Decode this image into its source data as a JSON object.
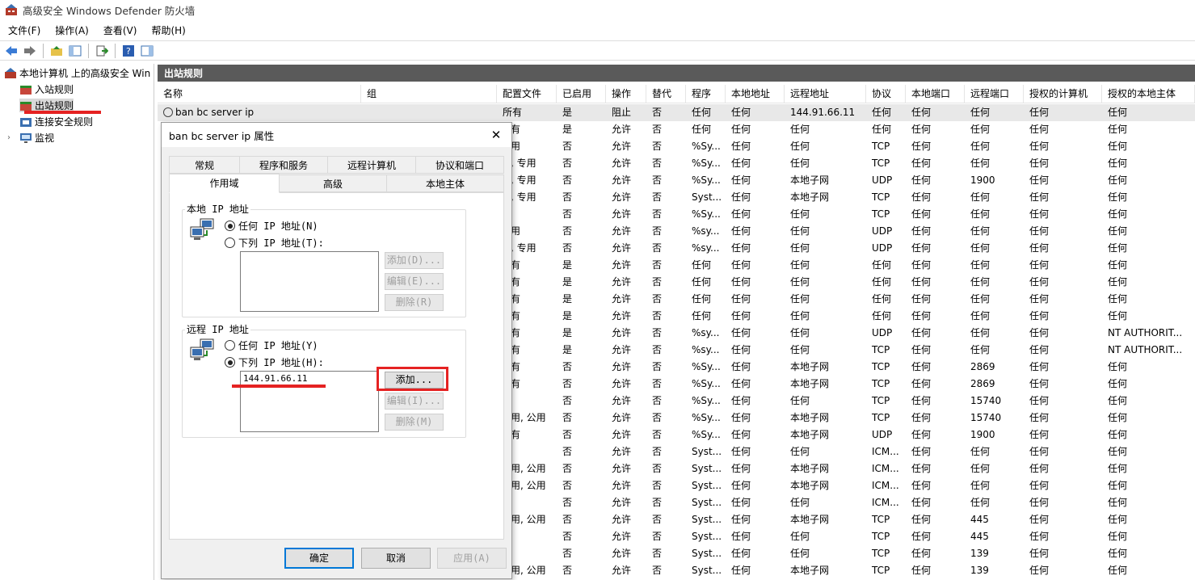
{
  "window": {
    "title": "高级安全 Windows Defender 防火墙"
  },
  "menu": [
    "文件(F)",
    "操作(A)",
    "查看(V)",
    "帮助(H)"
  ],
  "tree": {
    "root": "本地计算机 上的高级安全 Win",
    "items": [
      "入站规则",
      "出站规则",
      "连接安全规则",
      "监视"
    ]
  },
  "pane_title": "出站规则",
  "columns": [
    "名称",
    "组",
    "配置文件",
    "已启用",
    "操作",
    "替代",
    "程序",
    "本地地址",
    "远程地址",
    "协议",
    "本地端口",
    "远程端口",
    "授权的计算机",
    "授权的本地主体"
  ],
  "first_row": {
    "name": "ban bc server ip",
    "group": "",
    "profile": "所有",
    "enabled": "是",
    "action": "阻止",
    "override": "否",
    "program": "任何",
    "local": "任何",
    "remote": "144.91.66.11",
    "protocol": "任何",
    "lport": "任何",
    "rport": "任何",
    "authc": "任何",
    "authp": "任何"
  },
  "rows": [
    [
      "有",
      "是",
      "允许",
      "否",
      "任何",
      "任何",
      "任何",
      "任何",
      "任何",
      "任何",
      "任何",
      "任何"
    ],
    [
      "用",
      "否",
      "允许",
      "否",
      "%Sy...",
      "任何",
      "任何",
      "TCP",
      "任何",
      "任何",
      "任何",
      "任何"
    ],
    [
      ", 专用",
      "否",
      "允许",
      "否",
      "%Sy...",
      "任何",
      "任何",
      "TCP",
      "任何",
      "任何",
      "任何",
      "任何"
    ],
    [
      ", 专用",
      "否",
      "允许",
      "否",
      "%Sy...",
      "任何",
      "本地子网",
      "UDP",
      "任何",
      "1900",
      "任何",
      "任何"
    ],
    [
      ", 专用",
      "否",
      "允许",
      "否",
      "Syst...",
      "任何",
      "本地子网",
      "TCP",
      "任何",
      "任何",
      "任何",
      "任何"
    ],
    [
      "",
      "否",
      "允许",
      "否",
      "%Sy...",
      "任何",
      "任何",
      "TCP",
      "任何",
      "任何",
      "任何",
      "任何"
    ],
    [
      "用",
      "否",
      "允许",
      "否",
      "%sy...",
      "任何",
      "任何",
      "UDP",
      "任何",
      "任何",
      "任何",
      "任何"
    ],
    [
      ", 专用",
      "否",
      "允许",
      "否",
      "%sy...",
      "任何",
      "任何",
      "UDP",
      "任何",
      "任何",
      "任何",
      "任何"
    ],
    [
      "有",
      "是",
      "允许",
      "否",
      "任何",
      "任何",
      "任何",
      "任何",
      "任何",
      "任何",
      "任何",
      "任何"
    ],
    [
      "有",
      "是",
      "允许",
      "否",
      "任何",
      "任何",
      "任何",
      "任何",
      "任何",
      "任何",
      "任何",
      "任何"
    ],
    [
      "有",
      "是",
      "允许",
      "否",
      "任何",
      "任何",
      "任何",
      "任何",
      "任何",
      "任何",
      "任何",
      "任何"
    ],
    [
      "有",
      "是",
      "允许",
      "否",
      "任何",
      "任何",
      "任何",
      "任何",
      "任何",
      "任何",
      "任何",
      "任何"
    ],
    [
      "有",
      "是",
      "允许",
      "否",
      "%sy...",
      "任何",
      "任何",
      "UDP",
      "任何",
      "任何",
      "任何",
      "NT AUTHORIT..."
    ],
    [
      "有",
      "是",
      "允许",
      "否",
      "%sy...",
      "任何",
      "任何",
      "TCP",
      "任何",
      "任何",
      "任何",
      "NT AUTHORIT..."
    ],
    [
      "有",
      "否",
      "允许",
      "否",
      "%Sy...",
      "任何",
      "本地子网",
      "TCP",
      "任何",
      "2869",
      "任何",
      "任何"
    ],
    [
      "有",
      "否",
      "允许",
      "否",
      "%Sy...",
      "任何",
      "本地子网",
      "TCP",
      "任何",
      "2869",
      "任何",
      "任何"
    ],
    [
      "",
      "否",
      "允许",
      "否",
      "%Sy...",
      "任何",
      "任何",
      "TCP",
      "任何",
      "15740",
      "任何",
      "任何"
    ],
    [
      "用, 公用",
      "否",
      "允许",
      "否",
      "%Sy...",
      "任何",
      "本地子网",
      "TCP",
      "任何",
      "15740",
      "任何",
      "任何"
    ],
    [
      "有",
      "否",
      "允许",
      "否",
      "%Sy...",
      "任何",
      "本地子网",
      "UDP",
      "任何",
      "1900",
      "任何",
      "任何"
    ],
    [
      "",
      "否",
      "允许",
      "否",
      "Syst...",
      "任何",
      "任何",
      "ICM...",
      "任何",
      "任何",
      "任何",
      "任何"
    ],
    [
      "用, 公用",
      "否",
      "允许",
      "否",
      "Syst...",
      "任何",
      "本地子网",
      "ICM...",
      "任何",
      "任何",
      "任何",
      "任何"
    ],
    [
      "用, 公用",
      "否",
      "允许",
      "否",
      "Syst...",
      "任何",
      "本地子网",
      "ICM...",
      "任何",
      "任何",
      "任何",
      "任何"
    ],
    [
      "",
      "否",
      "允许",
      "否",
      "Syst...",
      "任何",
      "任何",
      "ICM...",
      "任何",
      "任何",
      "任何",
      "任何"
    ],
    [
      "用, 公用",
      "否",
      "允许",
      "否",
      "Syst...",
      "任何",
      "本地子网",
      "TCP",
      "任何",
      "445",
      "任何",
      "任何"
    ],
    [
      "",
      "否",
      "允许",
      "否",
      "Syst...",
      "任何",
      "任何",
      "TCP",
      "任何",
      "445",
      "任何",
      "任何"
    ],
    [
      "",
      "否",
      "允许",
      "否",
      "Syst...",
      "任何",
      "任何",
      "TCP",
      "任何",
      "139",
      "任何",
      "任何"
    ],
    [
      "用, 公用",
      "否",
      "允许",
      "否",
      "Syst...",
      "任何",
      "本地子网",
      "TCP",
      "任何",
      "139",
      "任何",
      "任何"
    ]
  ],
  "dialog": {
    "title": "ban bc server ip 属性",
    "close": "✕",
    "tabs_row1": [
      "常规",
      "程序和服务",
      "远程计算机",
      "协议和端口"
    ],
    "tabs_row2": [
      "作用域",
      "高级",
      "本地主体"
    ],
    "local_group": "本地 IP 地址",
    "local_any": "任何 IP 地址(N)",
    "local_list": "下列 IP 地址(T):",
    "remote_group": "远程 IP 地址",
    "remote_any": "任何 IP 地址(Y)",
    "remote_list": "下列 IP 地址(H):",
    "remote_ip": "144.91.66.11",
    "add_disabled": "添加(D)...",
    "edit_disabled": "编辑(E)...",
    "remove_disabled": "删除(R)",
    "add": "添加...",
    "edit2": "编辑(I)...",
    "remove2": "删除(M)",
    "ok": "确定",
    "cancel": "取消",
    "apply": "应用(A)"
  },
  "colors": {
    "header_bg": "#5a5a5a",
    "highlight": "#e52222",
    "focus": "#0078d7"
  }
}
